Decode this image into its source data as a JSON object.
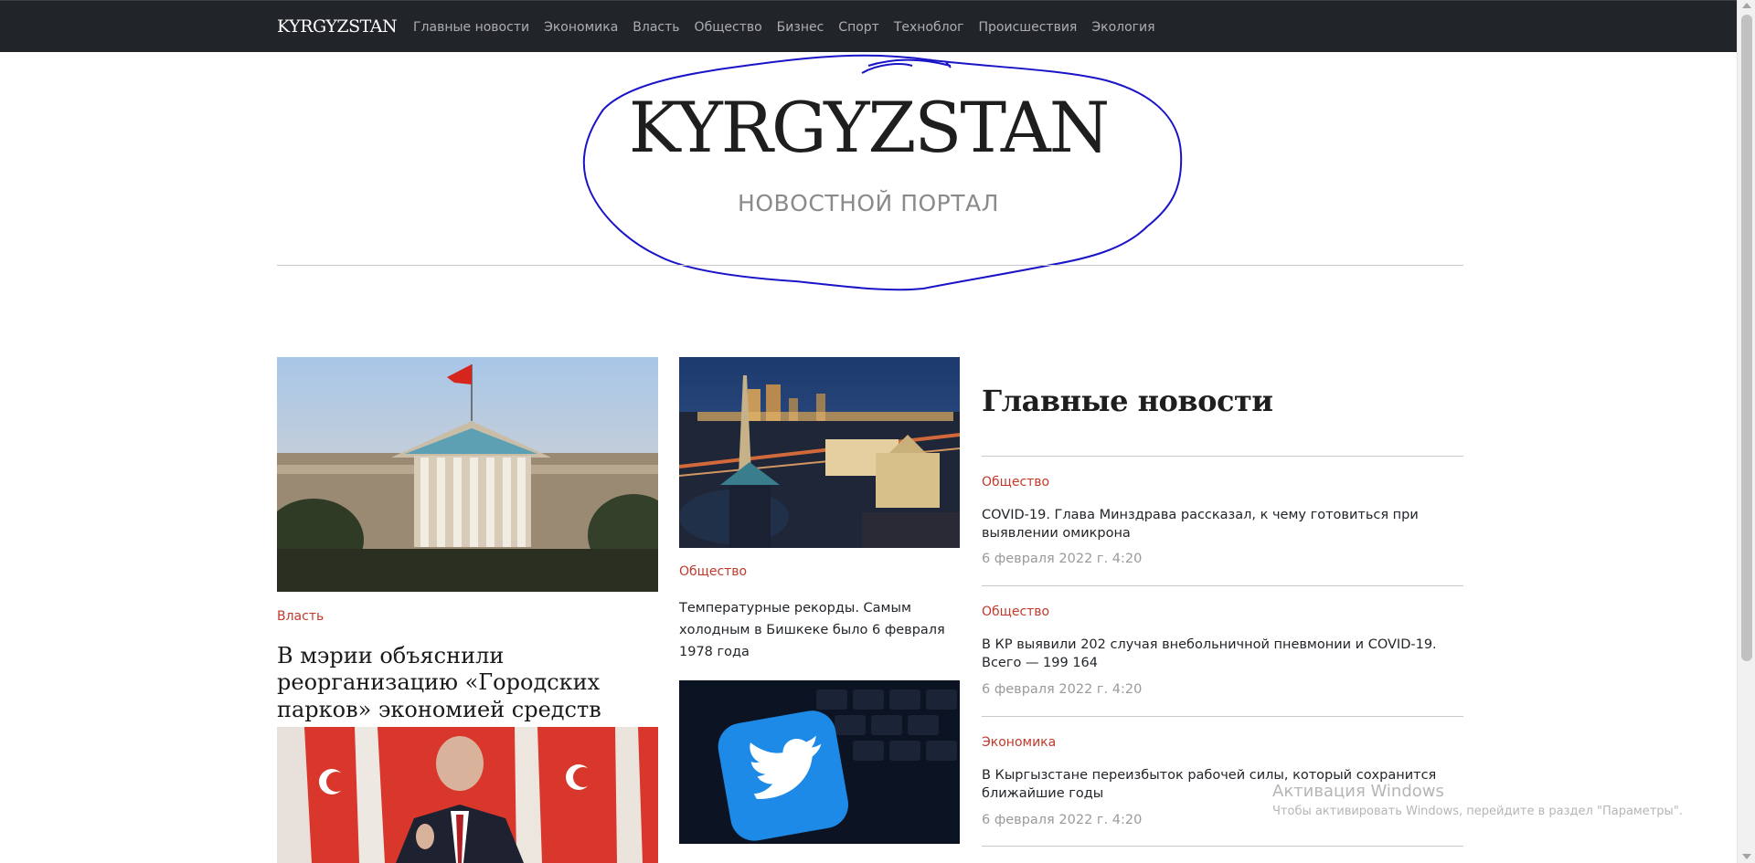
{
  "navbar": {
    "brand": "KYRGYZSTAN",
    "links": [
      "Главные новости",
      "Экономика",
      "Власть",
      "Общество",
      "Бизнес",
      "Спорт",
      "Техноблог",
      "Происшествия",
      "Экология"
    ]
  },
  "header": {
    "title": "KYRGYZSTAN",
    "subtitle": "НОВОСТНОЙ ПОРТАЛ"
  },
  "left_column": {
    "article1": {
      "category": "Власть",
      "title": "В мэрии объяснили реорганизацию «Городских парков» экономией средств"
    }
  },
  "middle_column": {
    "article1": {
      "category": "Общество",
      "title": "Температурные рекорды. Самым холодным в Бишкеке было 6 февраля 1978 года"
    }
  },
  "sidebar": {
    "title": "Главные новости",
    "items": [
      {
        "category": "Общество",
        "title": "COVID-19. Глава Минздрава рассказал, к чему готовиться при выявлении омикрона",
        "date": "6 февраля 2022 г. 4:20"
      },
      {
        "category": "Общество",
        "title": "В КР выявили 202 случая внебольничной пневмонии и COVID-19. Всего — 199 164",
        "date": "6 февраля 2022 г. 4:20"
      },
      {
        "category": "Экономика",
        "title": "В Кыргызстане переизбыток рабочей силы, который сохранится ближайшие годы",
        "date": "6 февраля 2022 г. 4:20"
      }
    ]
  },
  "watermark": {
    "line1": "Активация Windows",
    "line2": "Чтобы активировать Windows, перейдите в раздел \"Параметры\"."
  },
  "colors": {
    "navbar_bg": "#212529",
    "category_red": "#c0392b",
    "scribble_blue": "#1a14c8"
  }
}
